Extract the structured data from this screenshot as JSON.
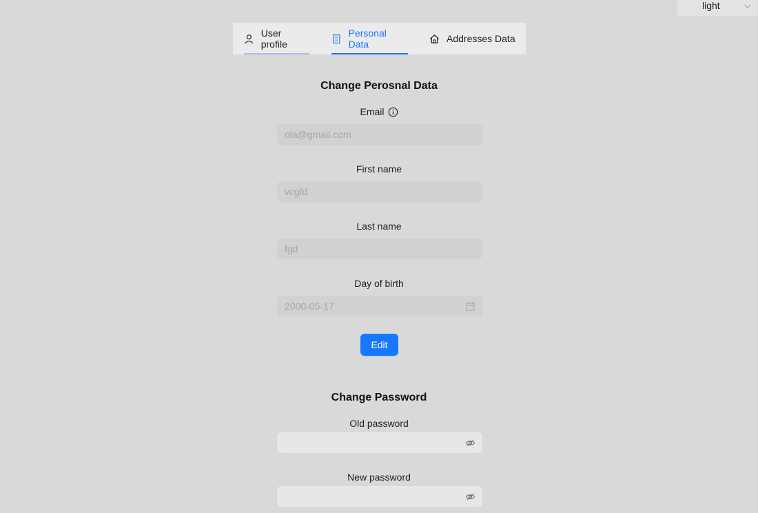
{
  "theme": {
    "selected": "light"
  },
  "tabs": [
    {
      "label": "User profile",
      "icon": "user-icon"
    },
    {
      "label": "Personal Data",
      "icon": "id-card-icon",
      "active": true
    },
    {
      "label": "Addresses Data",
      "icon": "home-icon"
    }
  ],
  "personal": {
    "title": "Change Perosnal Data",
    "email": {
      "label": "Email",
      "value": "ola@gmail.com"
    },
    "first_name": {
      "label": "First name",
      "value": "vcgfd"
    },
    "last_name": {
      "label": "Last name",
      "value": "fgd"
    },
    "dob": {
      "label": "Day of birth",
      "value": "2000-05-17"
    },
    "edit_label": "Edit"
  },
  "password": {
    "title": "Change Password",
    "old": {
      "label": "Old password",
      "value": ""
    },
    "new": {
      "label": "New password",
      "value": ""
    }
  },
  "colors": {
    "accent": "#1677ff",
    "background": "#d9d9d9"
  }
}
